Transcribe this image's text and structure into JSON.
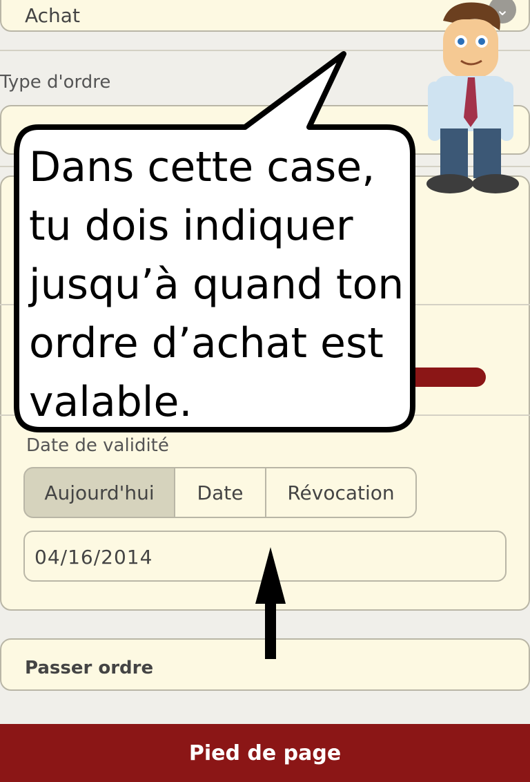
{
  "order": {
    "side_value": "Achat",
    "type_label": "Type d'ordre",
    "validity_label": "Date de validité",
    "validity_tabs": [
      {
        "label": "Aujourd'hui",
        "active": true
      },
      {
        "label": "Date",
        "active": false
      },
      {
        "label": "Révocation",
        "active": false
      }
    ],
    "date_value": "04/16/2014",
    "submit_label": "Passer ordre"
  },
  "footer": {
    "label": "Pied de page"
  },
  "tutorial": {
    "bubble_lines": [
      "Dans cette case,",
      "tu dois indiquer",
      "jusqu’à quand ton",
      "ordre d’achat est",
      "valable."
    ]
  },
  "colors": {
    "panel_bg": "#fdf9e2",
    "footer_bg": "#8b1616",
    "active_tab_bg": "#d6d3bd"
  }
}
